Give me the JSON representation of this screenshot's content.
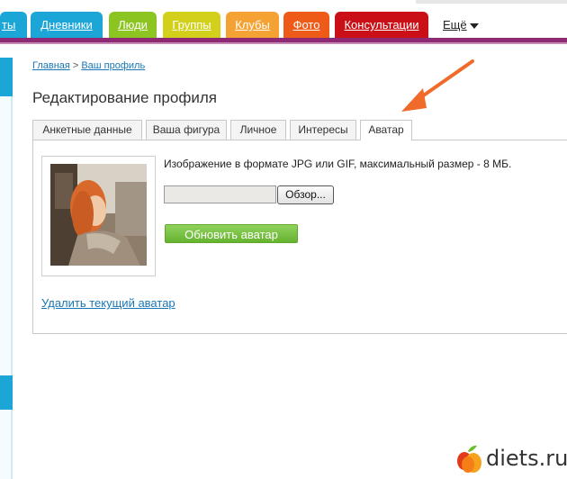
{
  "nav": {
    "tabs": [
      {
        "label": "ты"
      },
      {
        "label": "Дневники"
      },
      {
        "label": "Люди"
      },
      {
        "label": "Группы"
      },
      {
        "label": "Клубы"
      },
      {
        "label": "Фото"
      },
      {
        "label": "Консультации"
      }
    ],
    "more_label": "Ещё",
    "colors": {
      "blue": "#1ba6d7",
      "green": "#8cc421",
      "yellow": "#d3d01c",
      "orange": "#f5a235",
      "orange_red": "#ee5a17",
      "red": "#cb0f16",
      "stripe": "#8e2a73"
    }
  },
  "breadcrumb": {
    "items": [
      "Главная",
      "Ваш профиль"
    ],
    "separator": ">"
  },
  "page_title": "Редактирование профиля",
  "profile_tabs": [
    {
      "label": "Анкетные данные"
    },
    {
      "label": "Ваша фигура"
    },
    {
      "label": "Личное"
    },
    {
      "label": "Интересы"
    },
    {
      "label": "Аватар",
      "active": true
    }
  ],
  "avatar_section": {
    "hint": "Изображение в формате JPG или GIF, максимальный размер - 8 МБ.",
    "file_input_value": "",
    "browse_label": "Обзор...",
    "update_label": "Обновить аватар",
    "delete_label": "Удалить текущий аватар"
  },
  "watermark": {
    "logo_text": "diets.ru"
  }
}
